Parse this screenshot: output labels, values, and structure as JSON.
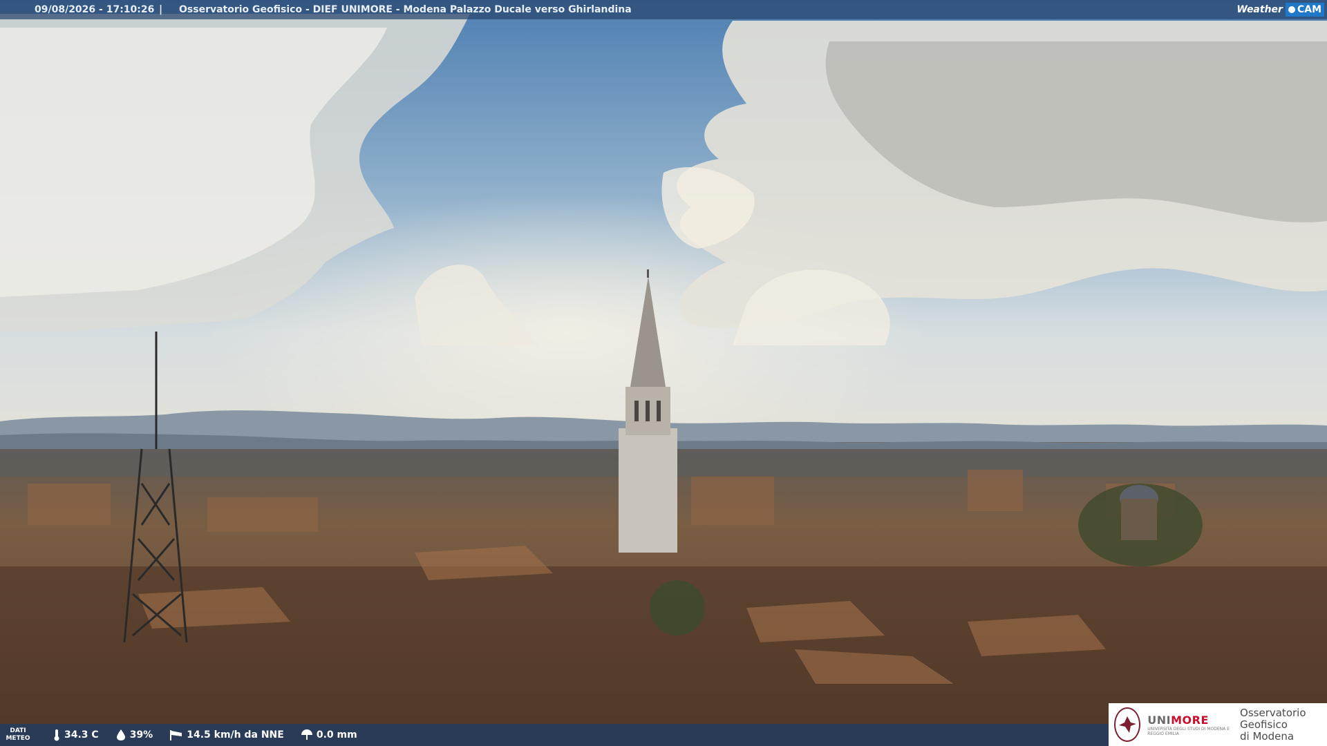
{
  "overlay": {
    "timestamp": "09/08/2026 - 17:10:26",
    "separator": "|",
    "camera_title": "Osservatorio Geofisico - DIEF UNIMORE - Modena Palazzo Ducale verso Ghirlandina",
    "brand_weather": "Weather",
    "brand_cam": "CAM"
  },
  "weather": {
    "label": "DATI METEO",
    "temperature": "34.3 C",
    "humidity": "39%",
    "wind": "14.5 km/h da NNE",
    "rain": "0.0 mm"
  },
  "logo": {
    "unimore_a": "UNI",
    "unimore_b": "MORE",
    "unimore_sub": "UNIVERSITÀ DEGLI STUDI DI MODENA E REGGIO EMILIA",
    "observatory_line1": "Osservatorio Geofisico",
    "observatory_line2": "di Modena"
  },
  "colors": {
    "overlay_bar": "#28466e",
    "unimore_red": "#c8102e",
    "weathercam_blue": "#1f78c8"
  }
}
